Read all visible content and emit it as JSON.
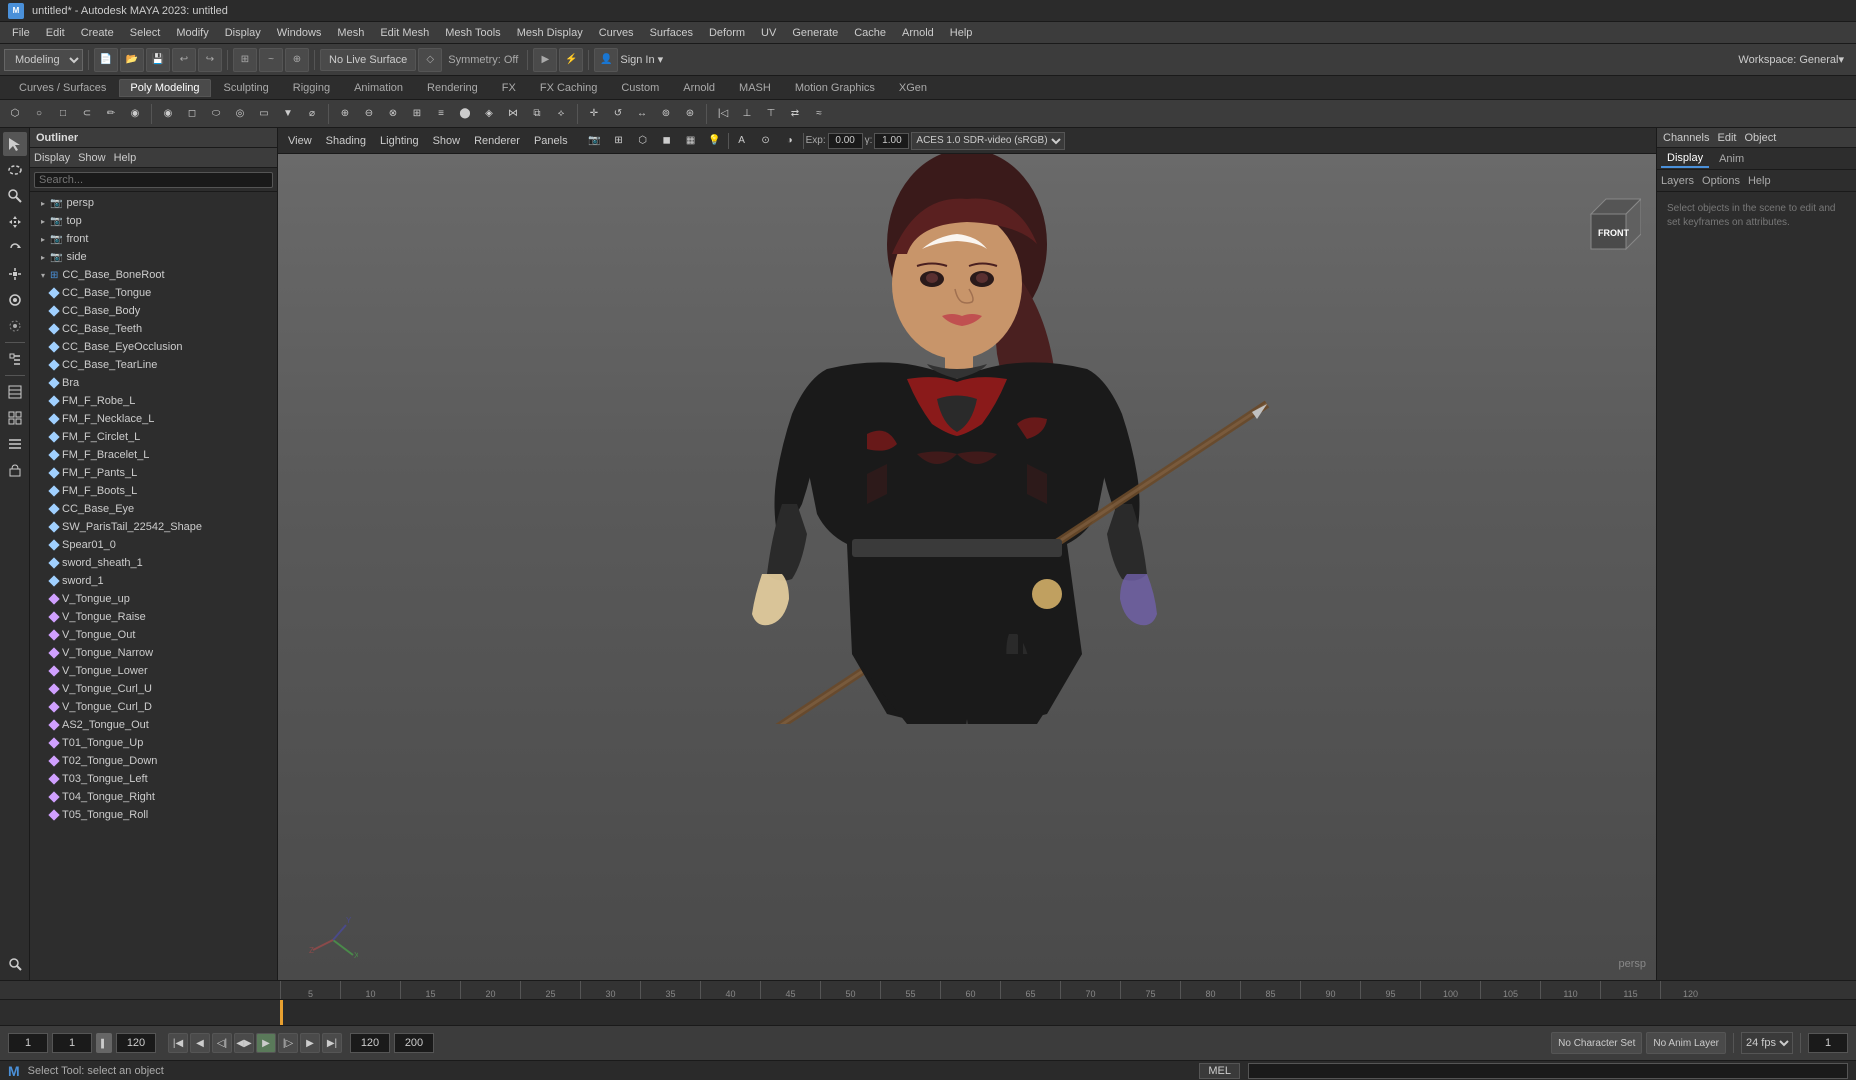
{
  "titlebar": {
    "title": "untitled* - Autodesk MAYA 2023: untitled",
    "app_icon": "M"
  },
  "menubar": {
    "items": [
      "File",
      "Edit",
      "Create",
      "Select",
      "Modify",
      "Display",
      "Windows",
      "Mesh",
      "Edit Mesh",
      "Mesh Tools",
      "Mesh Display",
      "Curves",
      "Surfaces",
      "Deform",
      "UV",
      "Generate",
      "Cache",
      "Arnold",
      "Help"
    ]
  },
  "toolbar": {
    "workspace_label": "Workspace: General▾",
    "modeling_label": "Modeling",
    "no_live_surface": "No Live Surface",
    "symmetry_label": "Symmetry: Off"
  },
  "tabs": {
    "items": [
      "Curves / Surfaces",
      "Poly Modeling",
      "Sculpting",
      "Rigging",
      "Animation",
      "Rendering",
      "FX",
      "FX Caching",
      "Custom",
      "Arnold",
      "MASH",
      "Motion Graphics",
      "XGen"
    ]
  },
  "outliner": {
    "title": "Outliner",
    "menu": [
      "Display",
      "Show",
      "Help"
    ],
    "search_placeholder": "Search...",
    "cameras": [
      {
        "name": "persp",
        "icon": "cam"
      },
      {
        "name": "top",
        "icon": "cam"
      },
      {
        "name": "front",
        "icon": "cam"
      },
      {
        "name": "side",
        "icon": "cam"
      }
    ],
    "nodes": [
      {
        "name": "CC_Base_BoneRoot",
        "type": "joint",
        "expanded": true
      },
      {
        "name": "CC_Base_Tongue",
        "type": "mesh"
      },
      {
        "name": "CC_Base_Body",
        "type": "mesh"
      },
      {
        "name": "CC_Base_Teeth",
        "type": "mesh"
      },
      {
        "name": "CC_Base_EyeOcclusion",
        "type": "mesh"
      },
      {
        "name": "CC_Base_TearLine",
        "type": "mesh"
      },
      {
        "name": "Bra",
        "type": "mesh"
      },
      {
        "name": "FM_F_Robe_L",
        "type": "mesh"
      },
      {
        "name": "FM_F_Necklace_L",
        "type": "mesh"
      },
      {
        "name": "FM_F_Circlet_L",
        "type": "mesh"
      },
      {
        "name": "FM_F_Bracelet_L",
        "type": "mesh"
      },
      {
        "name": "FM_F_Pants_L",
        "type": "mesh"
      },
      {
        "name": "FM_F_Boots_L",
        "type": "mesh"
      },
      {
        "name": "CC_Base_Eye",
        "type": "mesh"
      },
      {
        "name": "SW_ParisTail_22542_Shape",
        "type": "mesh"
      },
      {
        "name": "Spear01_0",
        "type": "mesh"
      },
      {
        "name": "sword_sheath_1",
        "type": "mesh"
      },
      {
        "name": "sword_1",
        "type": "mesh"
      },
      {
        "name": "V_Tongue_up",
        "type": "blendshape"
      },
      {
        "name": "V_Tongue_Raise",
        "type": "blendshape"
      },
      {
        "name": "V_Tongue_Out",
        "type": "blendshape"
      },
      {
        "name": "V_Tongue_Narrow",
        "type": "blendshape"
      },
      {
        "name": "V_Tongue_Lower",
        "type": "blendshape"
      },
      {
        "name": "V_Tongue_Curl_U",
        "type": "blendshape"
      },
      {
        "name": "V_Tongue_Curl_D",
        "type": "blendshape"
      },
      {
        "name": "AS2_Tongue_Out",
        "type": "blendshape"
      },
      {
        "name": "T01_Tongue_Up",
        "type": "blendshape"
      },
      {
        "name": "T02_Tongue_Down",
        "type": "blendshape"
      },
      {
        "name": "T03_Tongue_Left",
        "type": "blendshape"
      },
      {
        "name": "T04_Tongue_Right",
        "type": "blendshape"
      },
      {
        "name": "T05_Tongue_Roll",
        "type": "blendshape"
      }
    ]
  },
  "viewport": {
    "menu": [
      "View",
      "Shading",
      "Lighting",
      "Show",
      "Renderer",
      "Panels"
    ],
    "color_profile": "ACES 1.0 SDR-video (sRGB)",
    "persp_label": "persp",
    "front_cube_label": "FRONT",
    "exposure": "0.00",
    "gamma": "1.00"
  },
  "right_panel": {
    "tabs": [
      "Channels",
      "Edit",
      "Object"
    ],
    "sub_tabs": [
      "Display",
      "Anim"
    ],
    "options_tabs": [
      "Layers",
      "Options",
      "Help"
    ],
    "hint": "Select objects in the scene to edit and set keyframes on\nattributes."
  },
  "timeline": {
    "start": "1",
    "end": "120",
    "current": "1",
    "playback_end": "120",
    "fps": "24 fps",
    "range_start": "1",
    "range_end": "200",
    "ticks": [
      "5",
      "10",
      "15",
      "20",
      "25",
      "30",
      "35",
      "40",
      "45",
      "50",
      "55",
      "60",
      "65",
      "70",
      "75",
      "80",
      "85",
      "90",
      "95",
      "100",
      "105",
      "110",
      "115",
      "120"
    ]
  },
  "bottom_bar": {
    "frame_current": "1",
    "frame_start": "1",
    "no_character_set": "No Character Set",
    "no_anim_layer": "No Anim Layer",
    "fps": "24 fps"
  },
  "statusbar": {
    "message": "Select Tool: select an object",
    "mel_label": "MEL"
  }
}
